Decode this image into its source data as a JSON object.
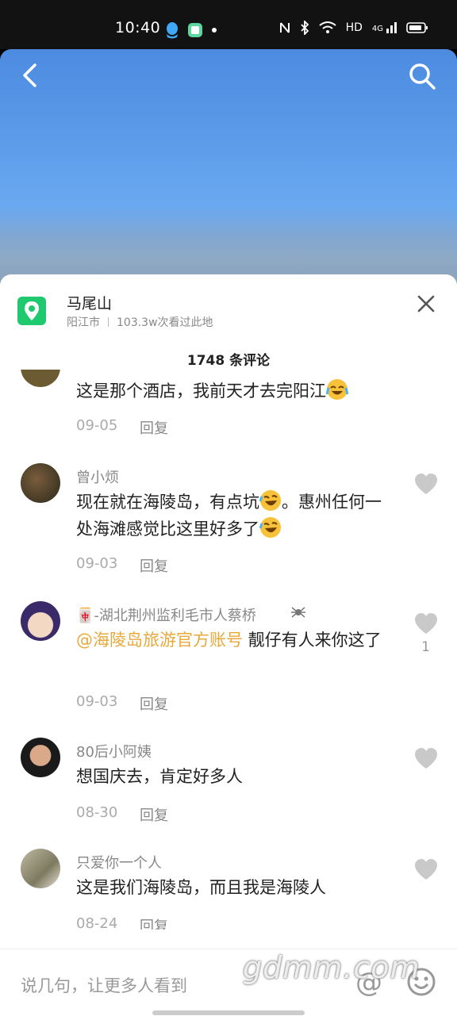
{
  "status_bar": {
    "time": "10:40",
    "network_label": "HD",
    "signal_label": "4G"
  },
  "location": {
    "name": "马尾山",
    "city": "阳江市",
    "visits": "103.3w次看过此地",
    "comment_count": "1748 条评论"
  },
  "comments": [
    {
      "username": "",
      "text": "这是那个酒店，我前天才去完阳江",
      "date": "09-05",
      "reply_label": "回复"
    },
    {
      "username": "曾小烦",
      "text_parts": [
        "现在就在海陵岛，有点坑",
        "。惠州任何一处海滩感觉比这里好多了"
      ],
      "date": "09-03",
      "reply_label": "回复"
    },
    {
      "username": "🀄-湖北荆州监利毛市人蔡桥",
      "mention": "@海陵岛旅游官方账号",
      "text": " 靓仔有人来你这了",
      "date": "09-03",
      "reply_label": "回复",
      "likes": "1"
    },
    {
      "username": "80后小阿姨",
      "text": "想国庆去，肯定好多人",
      "date": "08-30",
      "reply_label": "回复"
    },
    {
      "username": "只爱你一个人",
      "text": "这是我们海陵岛，而且我是海陵人",
      "date": "08-24",
      "reply_label": "回复"
    }
  ],
  "input": {
    "placeholder": "说几句，让更多人看到",
    "at_label": "@"
  },
  "watermark": "gdmm.com",
  "colors": {
    "accent_green": "#1fc96d",
    "mention": "#e8a93a"
  }
}
